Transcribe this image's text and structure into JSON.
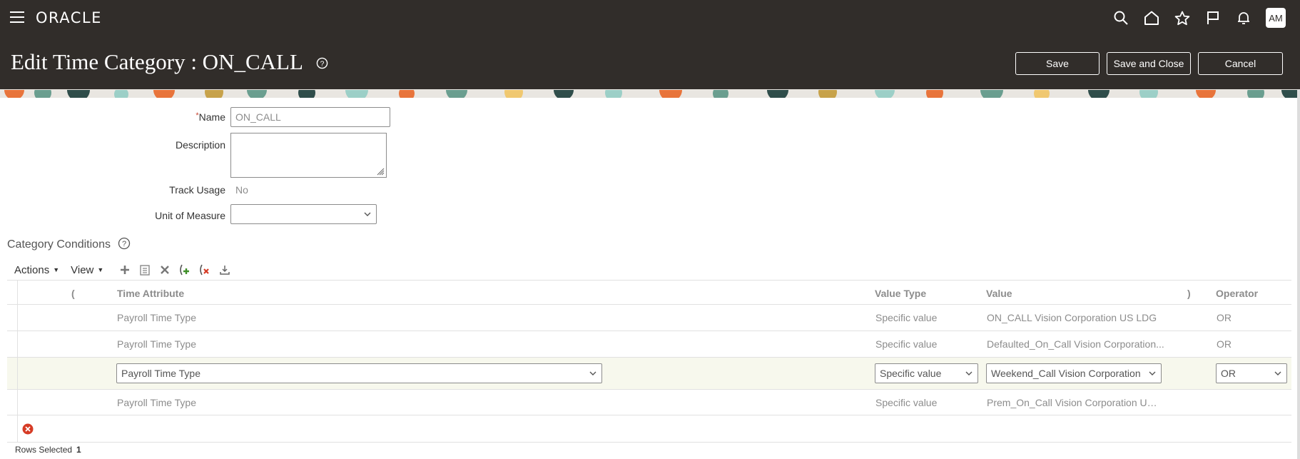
{
  "app": {
    "brand": "ORACLE",
    "user_initials": "AM"
  },
  "topbar": {
    "icons": [
      "menu-icon",
      "search-icon",
      "home-icon",
      "star-icon",
      "flag-icon",
      "bell-icon"
    ]
  },
  "page": {
    "title": "Edit Time Category : ON_CALL",
    "save_label": "Save",
    "save_close_label": "Save and Close",
    "cancel_label": "Cancel"
  },
  "form": {
    "required_mark": "*",
    "name_label": "Name",
    "name_value": "ON_CALL",
    "description_label": "Description",
    "description_value": "",
    "track_usage_label": "Track Usage",
    "track_usage_value": "No",
    "uom_label": "Unit of Measure",
    "uom_value": ""
  },
  "conditions": {
    "title": "Category Conditions",
    "actions_label": "Actions",
    "view_label": "View",
    "toolbar_icons": [
      "add-icon",
      "duplicate-icon",
      "delete-icon",
      "add-condition-icon",
      "remove-condition-icon",
      "export-icon"
    ],
    "headers": {
      "open_paren": "(",
      "time_attribute": "Time Attribute",
      "value_type": "Value Type",
      "value": "Value",
      "close_paren": ")",
      "operator": "Operator"
    },
    "rows": [
      {
        "time_attribute": "Payroll Time Type",
        "value_type": "Specific value",
        "value": "ON_CALL Vision Corporation US LDG",
        "operator": "OR",
        "selected": false
      },
      {
        "time_attribute": "Payroll Time Type",
        "value_type": "Specific value",
        "value": "Defaulted_On_Call Vision Corporation...",
        "operator": "OR",
        "selected": false
      },
      {
        "time_attribute": "Payroll Time Type",
        "value_type": "Specific value",
        "value": "Weekend_Call Vision Corporation U",
        "operator": "OR",
        "selected": true
      },
      {
        "time_attribute": "Payroll Time Type",
        "value_type": "Specific value",
        "value": "Prem_On_Call Vision Corporation US ...",
        "operator": "",
        "selected": false
      }
    ],
    "rows_selected_label": "Rows Selected",
    "rows_selected_count": "1"
  },
  "colors": {
    "header_bg": "#312d2a",
    "selected_row_bg": "#f7f8ed",
    "error_red": "#d63b25",
    "add_green": "#3f8f29"
  }
}
